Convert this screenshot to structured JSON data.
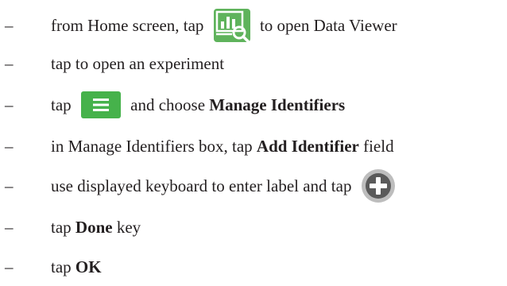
{
  "steps": [
    {
      "dash": "–",
      "parts": [
        {
          "text": "from Home screen, tap "
        },
        {
          "icon": "data-viewer-icon"
        },
        {
          "text": " to open Data Viewer"
        }
      ]
    },
    {
      "dash": "–",
      "parts": [
        {
          "text": "tap to open an experiment"
        }
      ]
    },
    {
      "dash": "–",
      "parts": [
        {
          "text": "tap "
        },
        {
          "icon": "menu-icon"
        },
        {
          "text": " and choose "
        },
        {
          "text": "Manage Identifiers",
          "bold": true
        }
      ]
    },
    {
      "dash": "–",
      "parts": [
        {
          "text": "in Manage Identifiers box, tap "
        },
        {
          "text": "Add Identifier",
          "bold": true
        },
        {
          "text": " field"
        }
      ]
    },
    {
      "dash": "–",
      "parts": [
        {
          "text": "use displayed keyboard to enter label and tap "
        },
        {
          "icon": "add-circle-icon"
        }
      ]
    },
    {
      "dash": "–",
      "parts": [
        {
          "text": "tap "
        },
        {
          "text": "Done",
          "bold": true
        },
        {
          "text": " key"
        }
      ]
    },
    {
      "dash": "–",
      "parts": [
        {
          "text": "tap "
        },
        {
          "text": "OK",
          "bold": true
        }
      ]
    }
  ],
  "colors": {
    "text": "#231f20",
    "data_viewer_bg": "#5fb35c",
    "menu_bg": "#46b24b",
    "plus_ring": "#bdbdbd",
    "plus_fill": "#5a5a5a"
  }
}
